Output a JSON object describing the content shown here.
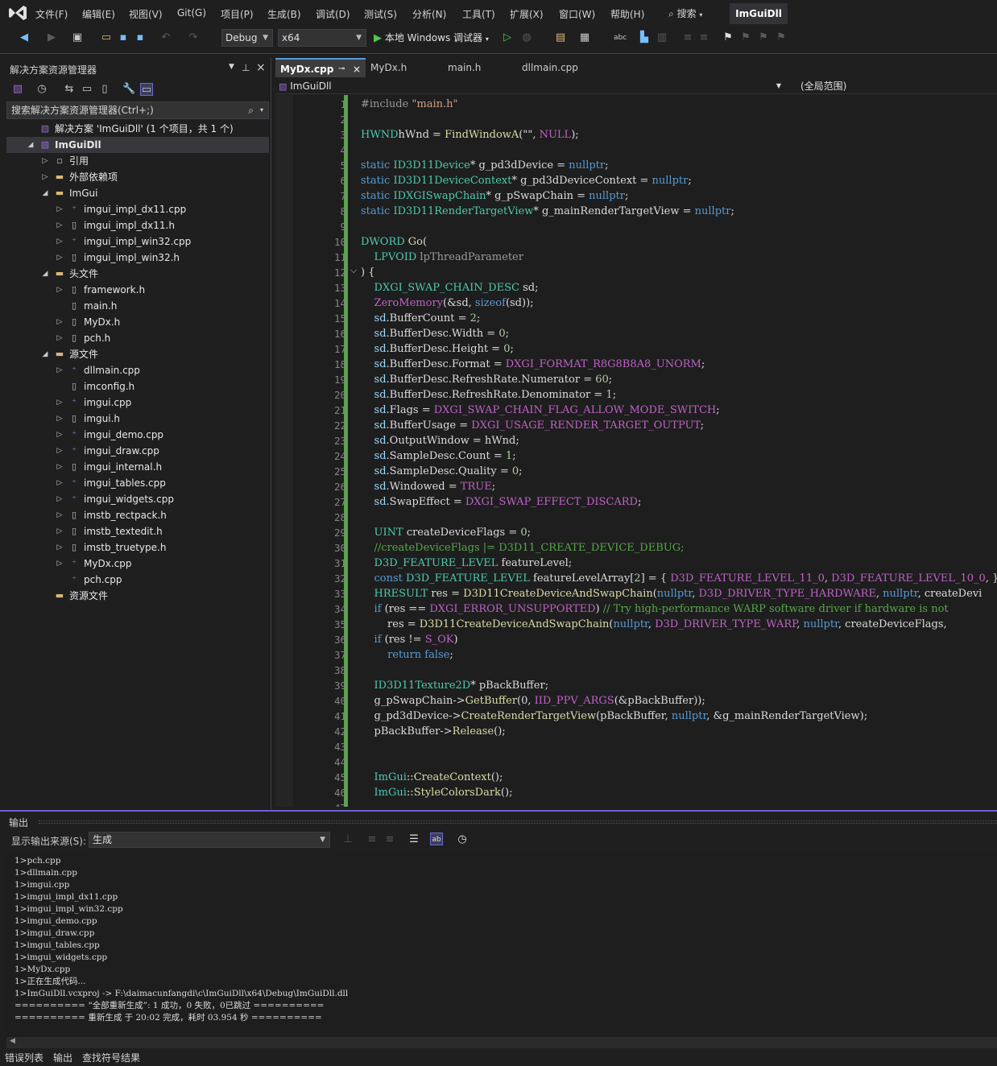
{
  "menubar": {
    "items": [
      "文件(F)",
      "编辑(E)",
      "视图(V)",
      "Git(G)",
      "项目(P)",
      "生成(B)",
      "调试(D)",
      "测试(S)",
      "分析(N)",
      "工具(T)",
      "扩展(X)",
      "窗口(W)",
      "帮助(H)"
    ],
    "search_label": "搜索",
    "solution_badge": "ImGuiDll"
  },
  "toolbar": {
    "configuration": "Debug",
    "platform": "x64",
    "run_label": "本地 Windows 调试器"
  },
  "solution_explorer": {
    "title": "解决方案资源管理器",
    "search_placeholder": "搜索解决方案资源管理器(Ctrl+;)",
    "tree": [
      {
        "label": "解决方案 'ImGuiDll' (1 个项目，共 1 个)",
        "icon": "solution-icon",
        "depth": 0,
        "expander": ""
      },
      {
        "label": "ImGuiDll",
        "icon": "project-icon",
        "depth": 0,
        "expander": "open",
        "selected": true,
        "bold": true
      },
      {
        "label": "引用",
        "icon": "reference-icon",
        "depth": 1,
        "expander": "closed"
      },
      {
        "label": "外部依赖项",
        "icon": "folder-icon",
        "depth": 1,
        "expander": "closed"
      },
      {
        "label": "ImGui",
        "icon": "folder-icon",
        "depth": 1,
        "expander": "open"
      },
      {
        "label": "imgui_impl_dx11.cpp",
        "icon": "cpp-file-icon",
        "depth": 2,
        "expander": "closed"
      },
      {
        "label": "imgui_impl_dx11.h",
        "icon": "header-file-icon",
        "depth": 2,
        "expander": "closed"
      },
      {
        "label": "imgui_impl_win32.cpp",
        "icon": "cpp-file-icon",
        "depth": 2,
        "expander": "closed"
      },
      {
        "label": "imgui_impl_win32.h",
        "icon": "header-file-icon",
        "depth": 2,
        "expander": "closed"
      },
      {
        "label": "头文件",
        "icon": "folder-icon",
        "depth": 1,
        "expander": "open"
      },
      {
        "label": "framework.h",
        "icon": "header-file-icon",
        "depth": 2,
        "expander": "closed"
      },
      {
        "label": "main.h",
        "icon": "header-file-icon",
        "depth": 2,
        "expander": ""
      },
      {
        "label": "MyDx.h",
        "icon": "header-file-icon",
        "depth": 2,
        "expander": "closed"
      },
      {
        "label": "pch.h",
        "icon": "header-file-icon",
        "depth": 2,
        "expander": "closed"
      },
      {
        "label": "源文件",
        "icon": "folder-icon",
        "depth": 1,
        "expander": "open"
      },
      {
        "label": "dllmain.cpp",
        "icon": "cpp-file-icon",
        "depth": 2,
        "expander": "closed"
      },
      {
        "label": "imconfig.h",
        "icon": "header-file-icon",
        "depth": 2,
        "expander": ""
      },
      {
        "label": "imgui.cpp",
        "icon": "cpp-file-icon",
        "depth": 2,
        "expander": "closed"
      },
      {
        "label": "imgui.h",
        "icon": "header-file-icon",
        "depth": 2,
        "expander": "closed"
      },
      {
        "label": "imgui_demo.cpp",
        "icon": "cpp-file-icon",
        "depth": 2,
        "expander": "closed"
      },
      {
        "label": "imgui_draw.cpp",
        "icon": "cpp-file-icon",
        "depth": 2,
        "expander": "closed"
      },
      {
        "label": "imgui_internal.h",
        "icon": "header-file-icon",
        "depth": 2,
        "expander": "closed"
      },
      {
        "label": "imgui_tables.cpp",
        "icon": "cpp-file-icon",
        "depth": 2,
        "expander": "closed"
      },
      {
        "label": "imgui_widgets.cpp",
        "icon": "cpp-file-icon",
        "depth": 2,
        "expander": "closed"
      },
      {
        "label": "imstb_rectpack.h",
        "icon": "header-file-icon",
        "depth": 2,
        "expander": "closed"
      },
      {
        "label": "imstb_textedit.h",
        "icon": "header-file-icon",
        "depth": 2,
        "expander": "closed"
      },
      {
        "label": "imstb_truetype.h",
        "icon": "header-file-icon",
        "depth": 2,
        "expander": "closed"
      },
      {
        "label": "MyDx.cpp",
        "icon": "cpp-file-icon",
        "depth": 2,
        "expander": "closed"
      },
      {
        "label": "pch.cpp",
        "icon": "cpp-file-icon",
        "depth": 2,
        "expander": ""
      },
      {
        "label": "资源文件",
        "icon": "folder-icon",
        "depth": 1,
        "expander": ""
      }
    ]
  },
  "editor": {
    "tabs": [
      {
        "label": "MyDx.cpp",
        "active": true
      },
      {
        "label": "MyDx.h",
        "active": false
      },
      {
        "label": "main.h",
        "active": false
      },
      {
        "label": "dllmain.cpp",
        "active": false
      }
    ],
    "nav_project": "ImGuiDll",
    "nav_scope": "(全局范围)",
    "lines": [
      [
        [
          "pp",
          "#include "
        ],
        [
          "s",
          "\"main.h\""
        ]
      ],
      [],
      [
        [
          "t",
          "HWND"
        ],
        [
          "",
          "hWnd = "
        ],
        [
          "f",
          "FindWindowA"
        ],
        [
          "",
          "(\"\", "
        ],
        [
          "m",
          "NULL"
        ],
        [
          "",
          ");"
        ]
      ],
      [],
      [
        [
          "k",
          "static "
        ],
        [
          "t",
          "ID3D11Device"
        ],
        [
          "",
          "* g_pd3dDevice = "
        ],
        [
          "k",
          "nullptr"
        ],
        [
          "",
          ";"
        ]
      ],
      [
        [
          "k",
          "static "
        ],
        [
          "t",
          "ID3D11DeviceContext"
        ],
        [
          "",
          "* g_pd3dDeviceContext = "
        ],
        [
          "k",
          "nullptr"
        ],
        [
          "",
          ";"
        ]
      ],
      [
        [
          "k",
          "static "
        ],
        [
          "t",
          "IDXGISwapChain"
        ],
        [
          "",
          "* g_pSwapChain = "
        ],
        [
          "k",
          "nullptr"
        ],
        [
          "",
          ";"
        ]
      ],
      [
        [
          "k",
          "static "
        ],
        [
          "t",
          "ID3D11RenderTargetView"
        ],
        [
          "",
          "* g_mainRenderTargetView = "
        ],
        [
          "k",
          "nullptr"
        ],
        [
          "",
          ";"
        ]
      ],
      [],
      [
        [
          "t",
          "DWORD "
        ],
        [
          "f",
          "Go"
        ],
        [
          "",
          "("
        ]
      ],
      [
        [
          "",
          "    "
        ],
        [
          "t",
          "LPVOID "
        ],
        [
          "pp",
          "lpThreadParameter"
        ]
      ],
      [
        [
          "",
          ") {"
        ]
      ],
      [
        [
          "",
          "    "
        ],
        [
          "t",
          "DXGI_SWAP_CHAIN_DESC "
        ],
        [
          "",
          "sd;"
        ]
      ],
      [
        [
          "",
          "    "
        ],
        [
          "m",
          "ZeroMemory"
        ],
        [
          "",
          "(&sd, "
        ],
        [
          "k",
          "sizeof"
        ],
        [
          "",
          "(sd));"
        ]
      ],
      [
        [
          "",
          "    "
        ],
        [
          "v",
          "sd"
        ],
        [
          "",
          ".BufferCount = "
        ],
        [
          "n",
          "2"
        ],
        [
          "",
          ";"
        ]
      ],
      [
        [
          "",
          "    "
        ],
        [
          "v",
          "sd"
        ],
        [
          "",
          ".BufferDesc.Width = "
        ],
        [
          "n",
          "0"
        ],
        [
          "",
          ";"
        ]
      ],
      [
        [
          "",
          "    "
        ],
        [
          "v",
          "sd"
        ],
        [
          "",
          ".BufferDesc.Height = "
        ],
        [
          "n",
          "0"
        ],
        [
          "",
          ";"
        ]
      ],
      [
        [
          "",
          "    "
        ],
        [
          "v",
          "sd"
        ],
        [
          "",
          ".BufferDesc.Format = "
        ],
        [
          "m",
          "DXGI_FORMAT_R8G8B8A8_UNORM"
        ],
        [
          "",
          ";"
        ]
      ],
      [
        [
          "",
          "    "
        ],
        [
          "v",
          "sd"
        ],
        [
          "",
          ".BufferDesc.RefreshRate.Numerator = "
        ],
        [
          "n",
          "60"
        ],
        [
          "",
          ";"
        ]
      ],
      [
        [
          "",
          "    "
        ],
        [
          "v",
          "sd"
        ],
        [
          "",
          ".BufferDesc.RefreshRate.Denominator = "
        ],
        [
          "n",
          "1"
        ],
        [
          "",
          ";"
        ]
      ],
      [
        [
          "",
          "    "
        ],
        [
          "v",
          "sd"
        ],
        [
          "",
          ".Flags = "
        ],
        [
          "m",
          "DXGI_SWAP_CHAIN_FLAG_ALLOW_MODE_SWITCH"
        ],
        [
          "",
          ";"
        ]
      ],
      [
        [
          "",
          "    "
        ],
        [
          "v",
          "sd"
        ],
        [
          "",
          ".BufferUsage = "
        ],
        [
          "m",
          "DXGI_USAGE_RENDER_TARGET_OUTPUT"
        ],
        [
          "",
          ";"
        ]
      ],
      [
        [
          "",
          "    "
        ],
        [
          "v",
          "sd"
        ],
        [
          "",
          ".OutputWindow = hWnd;"
        ]
      ],
      [
        [
          "",
          "    "
        ],
        [
          "v",
          "sd"
        ],
        [
          "",
          ".SampleDesc.Count = "
        ],
        [
          "n",
          "1"
        ],
        [
          "",
          ";"
        ]
      ],
      [
        [
          "",
          "    "
        ],
        [
          "v",
          "sd"
        ],
        [
          "",
          ".SampleDesc.Quality = "
        ],
        [
          "n",
          "0"
        ],
        [
          "",
          ";"
        ]
      ],
      [
        [
          "",
          "    "
        ],
        [
          "v",
          "sd"
        ],
        [
          "",
          ".Windowed = "
        ],
        [
          "m",
          "TRUE"
        ],
        [
          "",
          ";"
        ]
      ],
      [
        [
          "",
          "    "
        ],
        [
          "v",
          "sd"
        ],
        [
          "",
          ".SwapEffect = "
        ],
        [
          "m",
          "DXGI_SWAP_EFFECT_DISCARD"
        ],
        [
          "",
          ";"
        ]
      ],
      [],
      [
        [
          "",
          "    "
        ],
        [
          "t",
          "UINT "
        ],
        [
          "",
          "createDeviceFlags = "
        ],
        [
          "n",
          "0"
        ],
        [
          "",
          ";"
        ]
      ],
      [
        [
          "",
          "    "
        ],
        [
          "c",
          "//createDeviceFlags |= D3D11_CREATE_DEVICE_DEBUG;"
        ]
      ],
      [
        [
          "",
          "    "
        ],
        [
          "t",
          "D3D_FEATURE_LEVEL "
        ],
        [
          "",
          "featureLevel;"
        ]
      ],
      [
        [
          "",
          "    "
        ],
        [
          "k",
          "const "
        ],
        [
          "t",
          "D3D_FEATURE_LEVEL "
        ],
        [
          "",
          "featureLevelArray["
        ],
        [
          "n",
          "2"
        ],
        [
          "",
          "] = { "
        ],
        [
          "m",
          "D3D_FEATURE_LEVEL_11_0"
        ],
        [
          "",
          ", "
        ],
        [
          "m",
          "D3D_FEATURE_LEVEL_10_0"
        ],
        [
          "",
          ", };"
        ]
      ],
      [
        [
          "",
          "    "
        ],
        [
          "t",
          "HRESULT "
        ],
        [
          "",
          "res = "
        ],
        [
          "f",
          "D3D11CreateDeviceAndSwapChain"
        ],
        [
          "",
          "("
        ],
        [
          "k",
          "nullptr"
        ],
        [
          "",
          ", "
        ],
        [
          "m",
          "D3D_DRIVER_TYPE_HARDWARE"
        ],
        [
          "",
          ", "
        ],
        [
          "k",
          "nullptr"
        ],
        [
          "",
          ", createDevi"
        ]
      ],
      [
        [
          "",
          "    "
        ],
        [
          "k",
          "if "
        ],
        [
          "",
          "(res == "
        ],
        [
          "m",
          "DXGI_ERROR_UNSUPPORTED"
        ],
        [
          "",
          ") "
        ],
        [
          "c",
          "// Try high-performance WARP software driver if hardware is not"
        ]
      ],
      [
        [
          "",
          "        res = "
        ],
        [
          "f",
          "D3D11CreateDeviceAndSwapChain"
        ],
        [
          "",
          "("
        ],
        [
          "k",
          "nullptr"
        ],
        [
          "",
          ", "
        ],
        [
          "m",
          "D3D_DRIVER_TYPE_WARP"
        ],
        [
          "",
          ", "
        ],
        [
          "k",
          "nullptr"
        ],
        [
          "",
          ", createDeviceFlags,"
        ]
      ],
      [
        [
          "",
          "    "
        ],
        [
          "k",
          "if "
        ],
        [
          "",
          "(res != "
        ],
        [
          "m",
          "S_OK"
        ],
        [
          "",
          ")"
        ]
      ],
      [
        [
          "",
          "        "
        ],
        [
          "k",
          "return false"
        ],
        [
          "",
          ";"
        ]
      ],
      [],
      [
        [
          "",
          "    "
        ],
        [
          "t",
          "ID3D11Texture2D"
        ],
        [
          "",
          "* pBackBuffer;"
        ]
      ],
      [
        [
          "",
          "    g_pSwapChain->"
        ],
        [
          "f",
          "GetBuffer"
        ],
        [
          "",
          "(0, "
        ],
        [
          "m",
          "IID_PPV_ARGS"
        ],
        [
          "",
          "(&pBackBuffer));"
        ]
      ],
      [
        [
          "",
          "    g_pd3dDevice->"
        ],
        [
          "f",
          "CreateRenderTargetView"
        ],
        [
          "",
          "(pBackBuffer, "
        ],
        [
          "k",
          "nullptr"
        ],
        [
          "",
          ", &g_mainRenderTargetView);"
        ]
      ],
      [
        [
          "",
          "    pBackBuffer->"
        ],
        [
          "f",
          "Release"
        ],
        [
          "",
          "();"
        ]
      ],
      [],
      [],
      [
        [
          "",
          "    "
        ],
        [
          "t",
          "ImGui"
        ],
        [
          "",
          "::"
        ],
        [
          "f",
          "CreateContext"
        ],
        [
          "",
          "();"
        ]
      ],
      [
        [
          "",
          "    "
        ],
        [
          "t",
          "ImGui"
        ],
        [
          "",
          "::"
        ],
        [
          "f",
          "StyleColorsDark"
        ],
        [
          "",
          "();"
        ]
      ],
      []
    ]
  },
  "output": {
    "title": "输出",
    "source_label": "显示输出来源(S):",
    "source_value": "生成",
    "lines": [
      "1>pch.cpp",
      "1>dllmain.cpp",
      "1>imgui.cpp",
      "1>imgui_impl_dx11.cpp",
      "1>imgui_impl_win32.cpp",
      "1>imgui_demo.cpp",
      "1>imgui_draw.cpp",
      "1>imgui_tables.cpp",
      "1>imgui_widgets.cpp",
      "1>MyDx.cpp",
      "1>正在生成代码...",
      "1>ImGuiDll.vcxproj -> F:\\daimacunfangdi\\c\\ImGuiDll\\x64\\Debug\\ImGuiDll.dll",
      "========== “全部重新生成”: 1 成功，0 失败，0已跳过 ==========",
      "========== 重新生成 于 20:02 完成，耗时 03.954 秒 =========="
    ]
  },
  "bottom_tabs": [
    "错误列表",
    "输出",
    "查找符号结果"
  ]
}
